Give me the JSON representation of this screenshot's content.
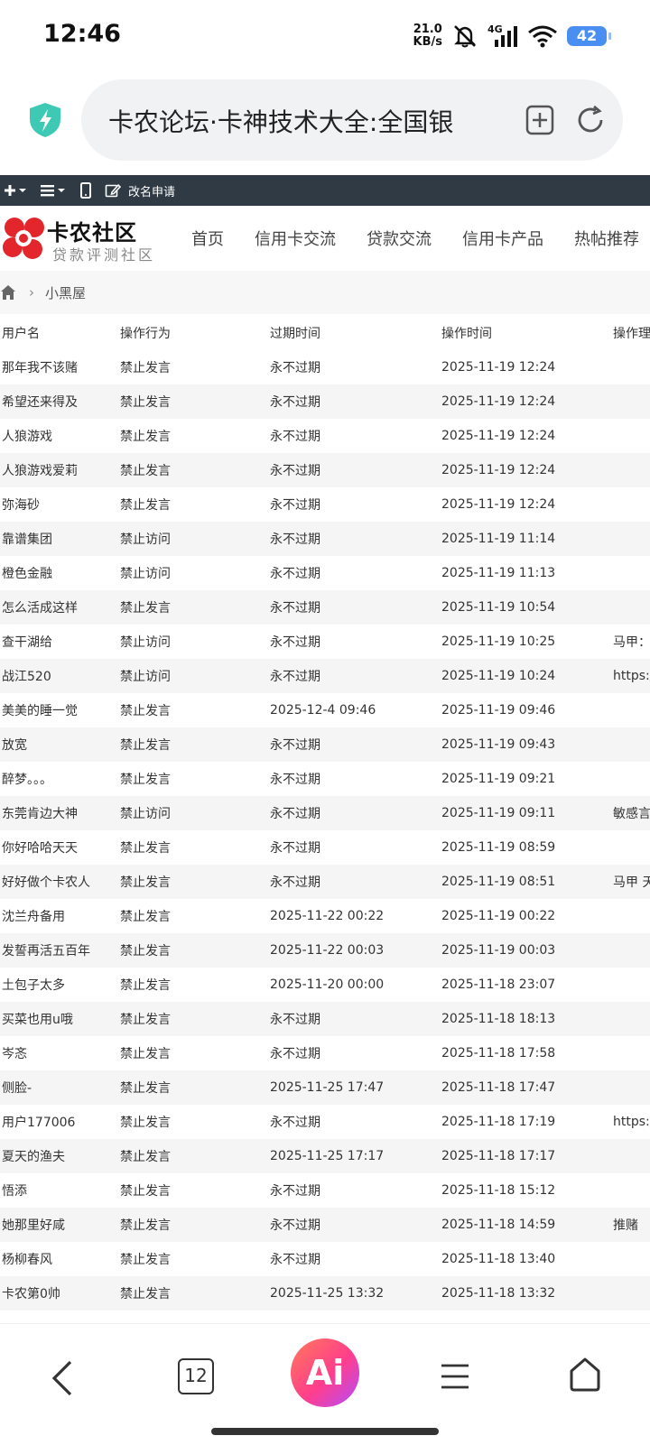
{
  "status_bar": {
    "time": "12:46",
    "net_speed_value": "21.0",
    "net_speed_unit": "KB/s",
    "network": "4G",
    "battery": "42",
    "icons": [
      "mute-icon",
      "signal-icon",
      "wifi-icon",
      "battery-icon"
    ]
  },
  "address_bar": {
    "url_title": "卡农论坛·卡神技术大全:全国银",
    "icons": [
      "shield-icon",
      "add-bookmark-icon",
      "reload-icon"
    ]
  },
  "forum_toolbar": {
    "rename_label": "改名申请",
    "icons": [
      "plus-icon",
      "list-icon",
      "mobile-icon",
      "edit-icon"
    ]
  },
  "site": {
    "logo_name": "卡农社区",
    "logo_sub": "贷款评测社区",
    "nav": [
      "首页",
      "信用卡交流",
      "贷款交流",
      "信用卡产品",
      "热帖推荐"
    ]
  },
  "breadcrumb": {
    "current": "小黑屋"
  },
  "table": {
    "headers": [
      "用户名",
      "操作行为",
      "过期时间",
      "操作时间",
      "操作理"
    ],
    "rows": [
      [
        "那年我不该赌",
        "禁止发言",
        "永不过期",
        "2025-11-19 12:24",
        ""
      ],
      [
        "希望还来得及",
        "禁止发言",
        "永不过期",
        "2025-11-19 12:24",
        ""
      ],
      [
        "人狼游戏",
        "禁止发言",
        "永不过期",
        "2025-11-19 12:24",
        ""
      ],
      [
        "人狼游戏爱莉",
        "禁止发言",
        "永不过期",
        "2025-11-19 12:24",
        ""
      ],
      [
        "弥海砂",
        "禁止发言",
        "永不过期",
        "2025-11-19 12:24",
        ""
      ],
      [
        "靠谱集团",
        "禁止访问",
        "永不过期",
        "2025-11-19 11:14",
        ""
      ],
      [
        "橙色金融",
        "禁止访问",
        "永不过期",
        "2025-11-19 11:13",
        ""
      ],
      [
        "怎么活成这样",
        "禁止发言",
        "永不过期",
        "2025-11-19 10:54",
        ""
      ],
      [
        "查干湖给",
        "禁止访问",
        "永不过期",
        "2025-11-19 10:25",
        "马甲："
      ],
      [
        "战江520",
        "禁止访问",
        "永不过期",
        "2025-11-19 10:24",
        "https:/"
      ],
      [
        "美美的睡一觉",
        "禁止发言",
        "2025-12-4 09:46",
        "2025-11-19 09:46",
        ""
      ],
      [
        "放宽",
        "禁止发言",
        "永不过期",
        "2025-11-19 09:43",
        ""
      ],
      [
        "醉梦。。。",
        "禁止发言",
        "永不过期",
        "2025-11-19 09:21",
        ""
      ],
      [
        "东莞肯边大神",
        "禁止访问",
        "永不过期",
        "2025-11-19 09:11",
        "敏感言"
      ],
      [
        "你好哈哈天天",
        "禁止发言",
        "永不过期",
        "2025-11-19 08:59",
        ""
      ],
      [
        "好好做个卡农人",
        "禁止发言",
        "永不过期",
        "2025-11-19 08:51",
        "马甲 天"
      ],
      [
        "沈兰舟备用",
        "禁止发言",
        "2025-11-22 00:22",
        "2025-11-19 00:22",
        ""
      ],
      [
        "发誓再活五百年",
        "禁止发言",
        "2025-11-22 00:03",
        "2025-11-19 00:03",
        ""
      ],
      [
        "土包子太多",
        "禁止发言",
        "2025-11-20 00:00",
        "2025-11-18 23:07",
        ""
      ],
      [
        "买菜也用u哦",
        "禁止发言",
        "永不过期",
        "2025-11-18 18:13",
        ""
      ],
      [
        "岑忞",
        "禁止发言",
        "永不过期",
        "2025-11-18 17:58",
        ""
      ],
      [
        "侧脸-",
        "禁止发言",
        "2025-11-25 17:47",
        "2025-11-18 17:47",
        ""
      ],
      [
        "用户177006",
        "禁止发言",
        "永不过期",
        "2025-11-18 17:19",
        "https:/"
      ],
      [
        "夏天的渔夫",
        "禁止发言",
        "2025-11-25 17:17",
        "2025-11-18 17:17",
        ""
      ],
      [
        "悟添",
        "禁止发言",
        "永不过期",
        "2025-11-18 15:12",
        ""
      ],
      [
        "她那里好咸",
        "禁止发言",
        "永不过期",
        "2025-11-18 14:59",
        "推赌"
      ],
      [
        "杨柳春风",
        "禁止发言",
        "永不过期",
        "2025-11-18 13:40",
        ""
      ],
      [
        "卡农第0帅",
        "禁止发言",
        "2025-11-25 13:32",
        "2025-11-18 13:32",
        ""
      ]
    ]
  },
  "bottom_nav": {
    "tabs_count": "12",
    "ai_label": "Ai",
    "icons": [
      "back-icon",
      "tabs-icon",
      "ai-icon",
      "menu-icon",
      "home-icon"
    ]
  }
}
